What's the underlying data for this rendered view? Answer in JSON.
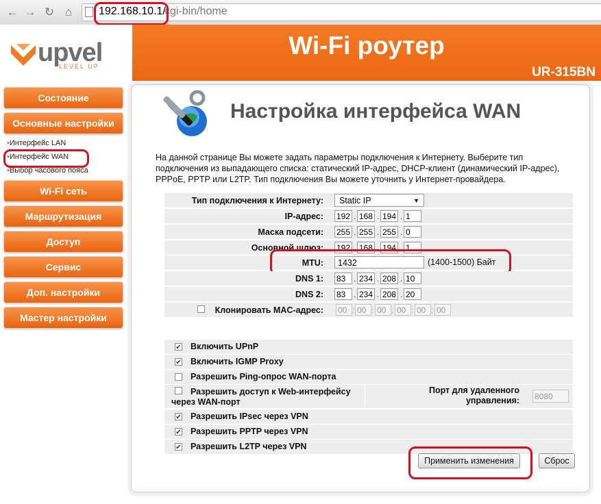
{
  "browser": {
    "url_host": "192.168.10.1/",
    "url_path": "cgi-bin/home"
  },
  "header": {
    "logo_text": "upvel",
    "logo_subtext": "LEVEL UP",
    "title": "Wi-Fi роутер",
    "model": "UR-315BN"
  },
  "sidebar": {
    "items": [
      {
        "label": "Состояние"
      },
      {
        "label": "Основные настройки"
      },
      {
        "label": "Wi-Fi сеть"
      },
      {
        "label": "Маршрутизация"
      },
      {
        "label": "Доступ"
      },
      {
        "label": "Сервис"
      },
      {
        "label": "Доп. настройки"
      },
      {
        "label": "Мастер настройки"
      }
    ],
    "subitems": [
      {
        "label": "Интерфейс LAN"
      },
      {
        "label": "Интерфейс WAN"
      },
      {
        "label": "Выбор часового пояса"
      }
    ]
  },
  "main": {
    "title": "Настройка интерфейса WAN",
    "description": "На данной странице Вы можете задать параметры подключения к Интернету. Выберите тип подключения из выпадающего списка: статический IP-адрес, DHCP-клиент (динамический IP-адрес), PPPoE, PPTP или L2TP. Тип подключения Вы можете уточнить у Интернет-провайдера.",
    "conn_type_label": "Тип подключения к Интернету:",
    "conn_type_value": "Static IP",
    "ip_label": "IP-адрес:",
    "ip": [
      "192",
      "168",
      "194",
      "1"
    ],
    "mask_label": "Маска подсети:",
    "mask": [
      "255",
      "255",
      "255",
      "0"
    ],
    "gw_label": "Основной шлюз:",
    "gw": [
      "192",
      "168",
      "194",
      "1"
    ],
    "mtu_label": "MTU:",
    "mtu_value": "1432",
    "mtu_hint": "(1400-1500) Байт",
    "dns1_label": "DNS 1:",
    "dns1": [
      "83",
      "234",
      "208",
      "10"
    ],
    "dns2_label": "DNS 2:",
    "dns2": [
      "83",
      "234",
      "208",
      "20"
    ],
    "clone_mac_label": "Клонировать MAC-адрес:",
    "mac": [
      "00",
      "00",
      "00",
      "00",
      "00",
      "00"
    ],
    "options": [
      {
        "label": "Включить UPnP",
        "checked": true
      },
      {
        "label": "Включить IGMP Proxy",
        "checked": true
      },
      {
        "label": "Разрешить Ping-опрос WAN-порта",
        "checked": false
      },
      {
        "label": "Разрешить доступ к Web-интерфейсу через WAN-порт",
        "checked": false
      },
      {
        "label": "Разрешить IPsec через VPN",
        "checked": true
      },
      {
        "label": "Разрешить PPTP через VPN",
        "checked": true
      },
      {
        "label": "Разрешить L2TP через VPN",
        "checked": true
      }
    ],
    "remote_port_label": "Порт для удаленного управления:",
    "remote_port_value": "8080",
    "apply_label": "Применить изменения",
    "reset_label": "Сброс"
  },
  "colors": {
    "brand_orange": "#ec6612",
    "highlight_red": "#d4111e"
  }
}
